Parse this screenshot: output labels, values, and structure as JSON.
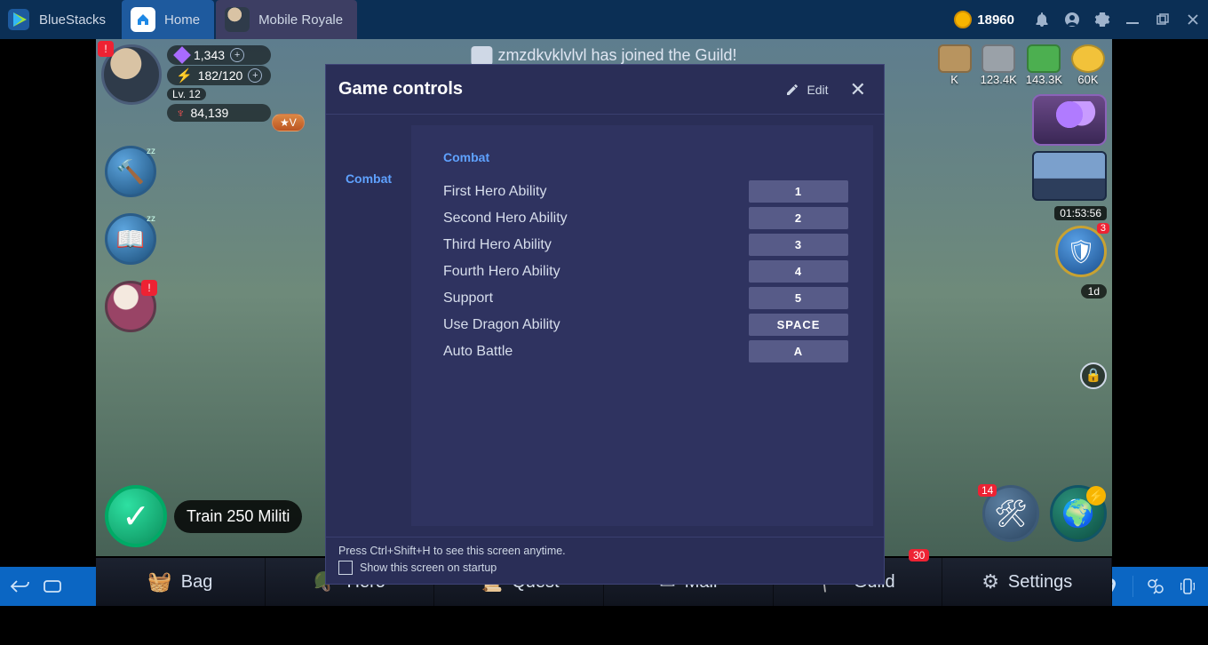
{
  "titlebar": {
    "brand": "BlueStacks",
    "tab_home": "Home",
    "tab_game": "Mobile Royale",
    "coins": "18960"
  },
  "player": {
    "level": "Lv. 12",
    "gems": "1,343",
    "energy": "182/120",
    "power": "84,139",
    "vip": "★V"
  },
  "banner": "zmzdkvklvlvl has joined the Guild!",
  "resources": {
    "k": "K",
    "r1": "123.4K",
    "r2": "143.3K",
    "r3": "60K"
  },
  "right": {
    "timer1": "01:53:56",
    "shield_count": "3",
    "shield_sub": "1d",
    "tools_count": "14",
    "guild_badge": "30"
  },
  "train": "Train 250 Militi",
  "nav": {
    "bag": "Bag",
    "hero": "Hero",
    "quest": "Quest",
    "mail": "Mail",
    "guild": "Guild",
    "settings": "Settings"
  },
  "dialog": {
    "title": "Game controls",
    "edit": "Edit",
    "category": "Combat",
    "section": "Combat",
    "rows": [
      {
        "label": "First Hero Ability",
        "key": "1"
      },
      {
        "label": "Second Hero Ability",
        "key": "2"
      },
      {
        "label": "Third Hero Ability",
        "key": "3"
      },
      {
        "label": "Fourth Hero Ability",
        "key": "4"
      },
      {
        "label": "Support",
        "key": "5"
      },
      {
        "label": "Use Dragon Ability",
        "key": "SPACE"
      },
      {
        "label": "Auto Battle",
        "key": "A"
      }
    ],
    "hint": "Press Ctrl+Shift+H to see this screen anytime.",
    "startup": "Show this screen on startup"
  }
}
